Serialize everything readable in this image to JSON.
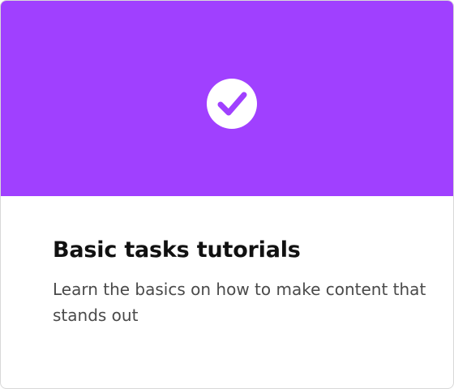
{
  "card": {
    "title": "Basic tasks tutorials",
    "description": "Learn the basics on how to make content that stands out",
    "icon": "checkmark-circle-icon",
    "accent_color": "#a040ff"
  }
}
